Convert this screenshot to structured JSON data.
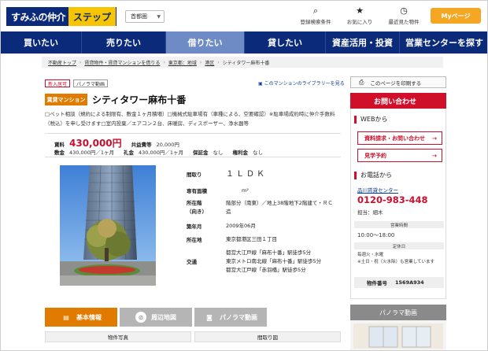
{
  "header": {
    "logo_main": "すみふの仲介",
    "logo_sub": "ステップ",
    "prefecture": "首都圏",
    "links": [
      {
        "label": "登録検索条件",
        "icon": "search-icon"
      },
      {
        "label": "お気に入り",
        "icon": "star-icon"
      },
      {
        "label": "最近見た物件",
        "icon": "clock-icon"
      }
    ],
    "mypage": "Myページ"
  },
  "nav": [
    "買いたい",
    "売りたい",
    "借りたい",
    "貸したい",
    "資産活用・投資",
    "営業センターを探す"
  ],
  "breadcrumb": [
    "不動産トップ",
    "賃貸物件・賃貸マンションを借りる",
    "東京都：地域",
    "港区",
    "シティタワー麻布十番"
  ],
  "tags": [
    "新入居可",
    "パノラマ動画"
  ],
  "library_link": "このマンションのライブラリーを見る",
  "property": {
    "type_badge": "賃貸マンション",
    "title": "シティタワー麻布十番",
    "description": "□ペット相談（規約による制限有、敷金１ヶ月積増）□機械式駐車場有（車種による、空要確認）※駐車場成約時に仲介手数料（税込）を申し受けます□室内投棄／エアコン２台、床暖房、ディスポーザー、浄水器等",
    "rent_label": "賃料",
    "rent": "430,000円",
    "common_label": "共益費等",
    "common": "20,000円",
    "deposit_label": "敷金",
    "deposit": "430,000円／1ヶ月",
    "key_label": "礼金",
    "key": "430,000円／1ヶ月",
    "guarantee_label": "保証金",
    "guarantee": "なし",
    "rights_label": "権利金",
    "rights": "なし"
  },
  "specs": [
    {
      "k": "間取り",
      "v": "１ＬＤＫ"
    },
    {
      "k": "専有面積",
      "v": "m²"
    },
    {
      "k": "所在階（向き）",
      "v": "階部分（南東）／地上38階地下2階建て・ＲＣ造"
    },
    {
      "k": "築年月",
      "v": "2009年06月"
    },
    {
      "k": "所在地",
      "v": "東京都港区三田１丁目"
    },
    {
      "k": "交通",
      "v": "都営大江戸線「麻布十番」駅徒歩5分"
    },
    {
      "k": "",
      "v": "東京メトロ南北線「麻布十番」駅徒歩5分"
    },
    {
      "k": "",
      "v": "都営大江戸線「赤羽橋」駅徒歩5分"
    }
  ],
  "tabs": [
    "基本情報",
    "周辺地図",
    "パノラマ動画"
  ],
  "subheads": [
    "物件写真",
    "間取り図"
  ],
  "side": {
    "print": "このページを印刷する",
    "inquiry": "お問い合わせ",
    "web_heading": "WEBから",
    "btn_request": "資料請求・お問い合わせ",
    "btn_visit": "見学予約",
    "phone_heading": "お電話から",
    "center": "品川賃貸センター",
    "phone": "0120-983-448",
    "staff": "担当：細木",
    "hours_label": "営業時間",
    "hours": "10:00～18:00",
    "holiday_label": "定休日",
    "holiday": "毎週火・水曜\n※土日・祝（火水除）も営業しています",
    "id_label": "物件番号",
    "id": "1569A934",
    "panorama": "パノラマ動画"
  },
  "colors": {
    "navy": "#0b2a7a",
    "orange": "#e07b00",
    "red": "#d0102b",
    "accent_yellow": "#f6c400"
  }
}
